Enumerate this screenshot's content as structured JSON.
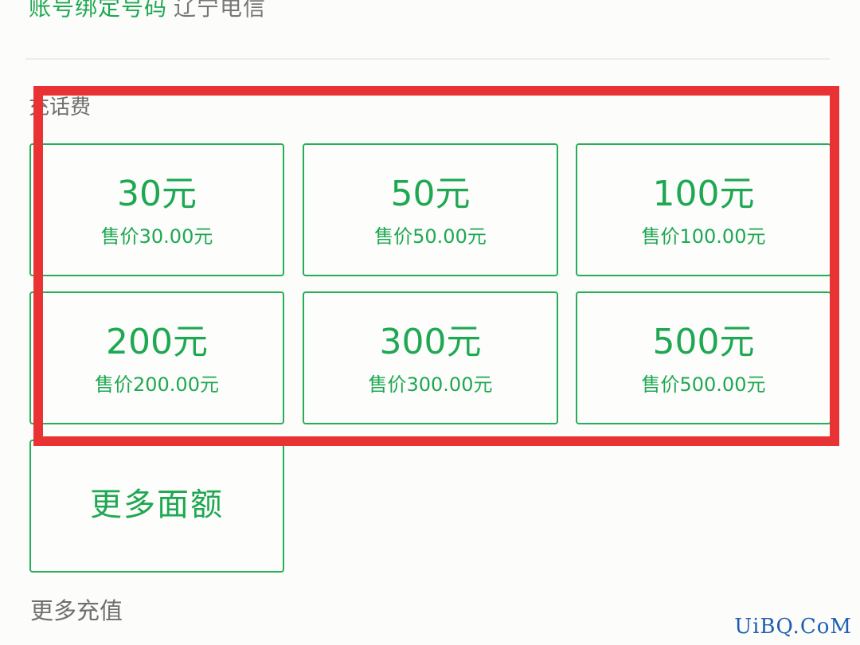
{
  "account": {
    "label": "账号绑定号码",
    "value": "辽宁电信"
  },
  "recharge_section": {
    "title": "充话费",
    "options": [
      {
        "amount": "30元",
        "price": "售价30.00元"
      },
      {
        "amount": "50元",
        "price": "售价50.00元"
      },
      {
        "amount": "100元",
        "price": "售价100.00元"
      },
      {
        "amount": "200元",
        "price": "售价200.00元"
      },
      {
        "amount": "300元",
        "price": "售价300.00元"
      },
      {
        "amount": "500元",
        "price": "售价500.00元"
      }
    ],
    "more_label": "更多面额"
  },
  "more_recharge": {
    "title": "更多充值"
  },
  "watermark": "UiBQ.CoM",
  "colors": {
    "accent_green": "#1ea852",
    "highlight_red": "#e83234",
    "text_gray": "#6f6f6f"
  }
}
